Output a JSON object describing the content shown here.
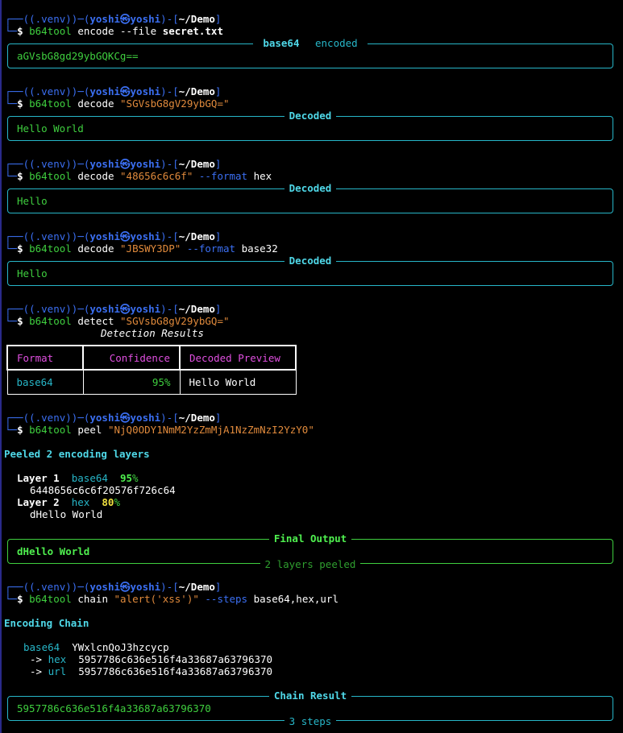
{
  "prompt": {
    "venv": "(.venv)",
    "user": "yoshi",
    "host": "yoshi",
    "path": "~/Demo"
  },
  "commands": [
    {
      "tool": "b64tool",
      "sub": "encode",
      "args": "--file",
      "arg2": "secret.txt"
    },
    {
      "tool": "b64tool",
      "sub": "decode",
      "args": "\"SGVsbG8gV29ybGQ=\""
    },
    {
      "tool": "b64tool",
      "sub": "decode",
      "args": "\"48656c6c6f\"",
      "flag": "--format",
      "flagval": "hex"
    },
    {
      "tool": "b64tool",
      "sub": "decode",
      "args": "\"JBSWY3DP\"",
      "flag": "--format",
      "flagval": "base32"
    },
    {
      "tool": "b64tool",
      "sub": "detect",
      "args": "\"SGVsbG8gV29ybGQ=\""
    },
    {
      "tool": "b64tool",
      "sub": "peel",
      "args": "\"NjQ0ODY1NmM2YzZmMjA1NzZmNzI2YzY0\""
    },
    {
      "tool": "b64tool",
      "sub": "chain",
      "args": "\"alert('xss')\"",
      "flag": "--steps",
      "flagval": "base64,hex,url"
    }
  ],
  "panels": {
    "encode": {
      "title_a": "base64",
      "title_b": "encoded",
      "body": "aGVsbG8gd29ybGQKCg=="
    },
    "decode1": {
      "title": "Decoded",
      "body": "Hello World"
    },
    "decode2": {
      "title": "Decoded",
      "body": "Hello"
    },
    "decode3": {
      "title": "Decoded",
      "body": "Hello"
    },
    "final": {
      "title": "Final Output",
      "body": "dHello World",
      "footer": "2 layers peeled"
    },
    "chain": {
      "title": "Chain Result",
      "body": "5957786c636e516f4a33687a63796370",
      "footer": "3 steps"
    }
  },
  "detect": {
    "caption": "Detection Results",
    "headers": [
      "Format",
      "Confidence",
      "Decoded Preview"
    ],
    "rows": [
      [
        "base64",
        "95%",
        "Hello World"
      ]
    ]
  },
  "peel": {
    "heading": "Peeled 2 encoding layers",
    "layers": [
      {
        "label": "Layer 1",
        "format": "base64",
        "conf": "95",
        "pct": "%",
        "value": "6448656c6c6f20576f726c64"
      },
      {
        "label": "Layer 2",
        "format": "hex",
        "conf": "80",
        "pct": "%",
        "value": "dHello World"
      }
    ]
  },
  "chain": {
    "heading": "Encoding Chain",
    "steps": [
      {
        "prefix": "",
        "format": "base64",
        "value": "YWxlcnQoJ3hzcycp"
      },
      {
        "prefix": "->",
        "format": "hex",
        "value": "5957786c636e516f4a33687a63796370"
      },
      {
        "prefix": "->",
        "format": "url",
        "value": "5957786c636e516f4a33687a63796370"
      }
    ]
  },
  "colors": {
    "prompt": "#3b6ff2",
    "panel_border": "#27b6c8",
    "output_green": "#3fcf3f",
    "string_orange": "#e08a3c",
    "header_magenta": "#e04fe0"
  }
}
